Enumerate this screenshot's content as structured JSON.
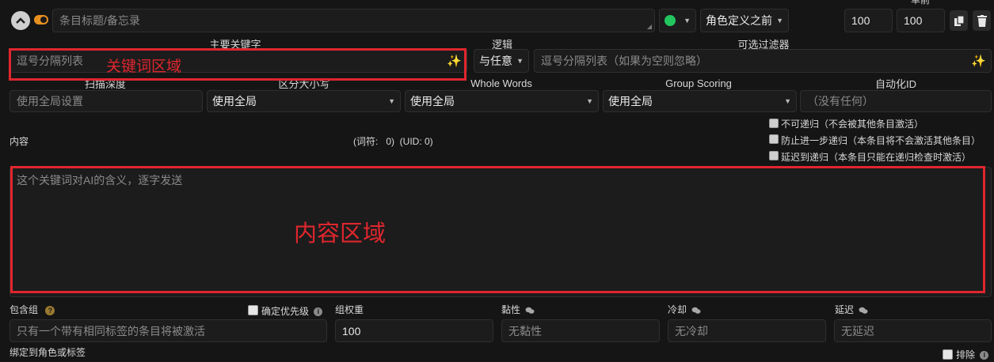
{
  "header": {
    "title_placeholder": "条目标题/备忘录",
    "status_color": "#22c55e",
    "position_value": "角色定义之前",
    "order_value": "100",
    "probability_value": "100",
    "clipped_label": "单前"
  },
  "keywords": {
    "primary_label": "主要关键字",
    "primary_placeholder": "逗号分隔列表",
    "logic_label": "逻辑",
    "logic_value": "与任意",
    "filter_label": "可选过滤器",
    "filter_placeholder": "逗号分隔列表（如果为空则忽略）"
  },
  "scan_row": {
    "scan_depth_label": "扫描深度",
    "scan_depth_placeholder": "使用全局设置",
    "case_label": "区分大小写",
    "case_value": "使用全局",
    "whole_words_label": "Whole Words",
    "whole_words_value": "使用全局",
    "group_scoring_label": "Group Scoring",
    "group_scoring_value": "使用全局",
    "automation_label": "自动化ID",
    "automation_placeholder": "（没有任何）"
  },
  "content": {
    "label": "内容",
    "token_info": "(词符:   0)  (UID: 0)",
    "placeholder": "这个关键词对AI的含义，逐字发送",
    "recursion_options": [
      "不可递归（不会被其他条目激活）",
      "防止进一步递归（本条目将不会激活其他条目）",
      "延迟到递归（本条目只能在递归检查时激活）"
    ]
  },
  "bottom": {
    "group_label": "包含组",
    "group_help": "?",
    "prioritize_label": "确定优先级",
    "group_placeholder": "只有一个带有相同标签的条目将被激活",
    "weight_label": "组权重",
    "weight_value": "100",
    "sticky_label": "黏性",
    "sticky_placeholder": "无黏性",
    "cooldown_label": "冷却",
    "cooldown_placeholder": "无冷却",
    "delay_label": "延迟",
    "delay_placeholder": "无延迟",
    "bind_label": "绑定到角色或标签",
    "exclude_label": "排除"
  },
  "annotations": {
    "keyword_region": "关键词区域",
    "content_region": "内容区域",
    "color": "#e0262e"
  }
}
